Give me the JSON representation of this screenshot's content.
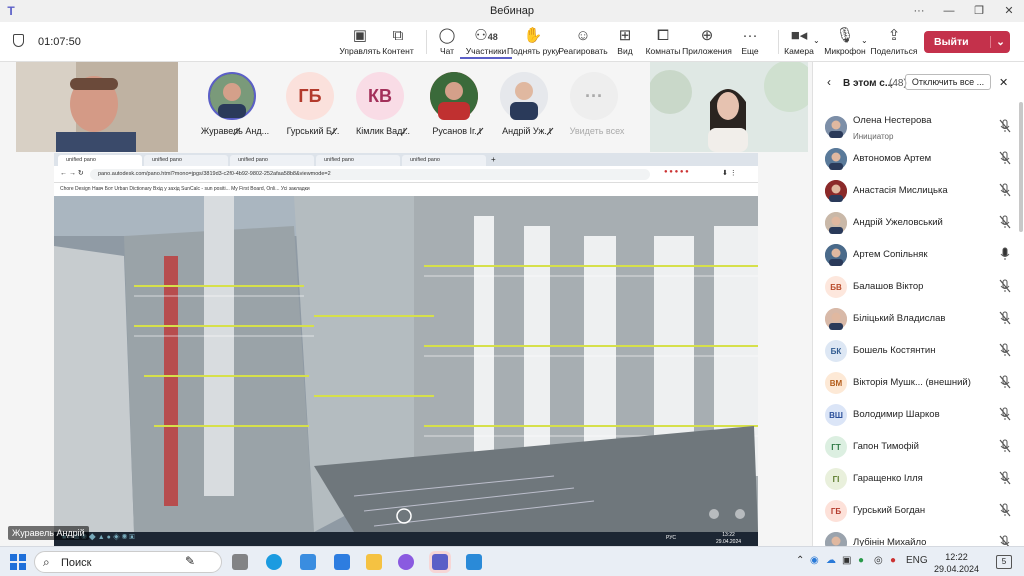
{
  "window": {
    "title": "Вебинар",
    "app_icon": "teams-icon"
  },
  "meeting": {
    "timer": "01:07:50"
  },
  "toolbar": {
    "buttons": [
      {
        "label": "Управлять",
        "icon": "present-icon"
      },
      {
        "label": "Контент",
        "icon": "share-icon"
      },
      {
        "label": "Чат",
        "icon": "chat-icon"
      },
      {
        "label": "Участники",
        "icon": "people-icon",
        "badge": "48"
      },
      {
        "label": "Поднять руку",
        "icon": "hand-icon"
      },
      {
        "label": "Реагировать",
        "icon": "react-icon"
      },
      {
        "label": "Вид",
        "icon": "view-icon"
      },
      {
        "label": "Комнаты",
        "icon": "rooms-icon"
      },
      {
        "label": "Приложения",
        "icon": "apps-icon"
      },
      {
        "label": "Еще",
        "icon": "more-icon"
      },
      {
        "label": "Камера",
        "icon": "camera-icon"
      },
      {
        "label": "Микрофон",
        "icon": "mic-off-icon"
      },
      {
        "label": "Поделиться",
        "icon": "upload-icon"
      }
    ],
    "leave_label": "Выйти"
  },
  "gallery": {
    "participants": [
      {
        "name": "Журавель Анд...",
        "type": "photo"
      },
      {
        "name": "Гурський Б...",
        "initials": "ГБ",
        "color": "#fbe1dc",
        "text_color": "#b33a2c"
      },
      {
        "name": "Кімлик Вад...",
        "initials": "КВ",
        "color": "#f9dce6",
        "text_color": "#a3305a"
      },
      {
        "name": "Русанов Іг...",
        "type": "photo"
      },
      {
        "name": "Андрій Уж...",
        "type": "photo"
      }
    ],
    "see_all": "Увидеть всех"
  },
  "share": {
    "presenter": "Журавель Андрій",
    "tabs": [
      "unified pano",
      "unified pano",
      "unified pano",
      "unified pano",
      "unified pano"
    ],
    "url": "pano.autodesk.com/pano.html?mono=jpgs/3819d3-c2f0-4b92-9802-252afaa58b8&viewmode=2",
    "bookmarks": "Chore  Design  Навч  Бот  Urban Dictionary  Вхід у захід  SunCalc - sun positi...  My First Board, Onli...  Усі закладки",
    "clock": "13:22",
    "date": "29.04.2024",
    "lang": "РУС"
  },
  "panel": {
    "title": "В этом с...",
    "count": "(48)",
    "mute_all": "Отключить все ...",
    "participants": [
      {
        "name": "Олена Нестерова",
        "role": "Инициатор",
        "avatar": "photo",
        "color": "#7d8fa8",
        "mic": "off"
      },
      {
        "name": "Автономов Артем",
        "avatar": "photo",
        "color": "#5a7a9a",
        "mic": "off"
      },
      {
        "name": "Анастасія Мислицька",
        "avatar": "photo",
        "color": "#8b2a2a",
        "mic": "off"
      },
      {
        "name": "Андрій Ужеловський",
        "avatar": "photo",
        "color": "#c9b8a8",
        "mic": "off"
      },
      {
        "name": "Артем Сопільняк",
        "avatar": "photo",
        "color": "#4a6a8a",
        "mic": "on"
      },
      {
        "name": "Балашов Віктор",
        "initials": "БВ",
        "color": "#fde7dd",
        "text_color": "#b84a2a",
        "mic": "off"
      },
      {
        "name": "Біліцький Владислав",
        "avatar": "photo",
        "color": "#d8b9a8",
        "mic": "off"
      },
      {
        "name": "Бошель Костянтин",
        "initials": "БК",
        "color": "#dde7f4",
        "text_color": "#2f5a8f",
        "mic": "off"
      },
      {
        "name": "Вікторія Мушк... (внешний)",
        "initials": "ВМ",
        "color": "#fde9d6",
        "text_color": "#b35c1a",
        "mic": "off"
      },
      {
        "name": "Володимир Шарков",
        "initials": "ВШ",
        "color": "#dbe5f7",
        "text_color": "#2b4f9a",
        "mic": "off"
      },
      {
        "name": "Гапон Тимофій",
        "initials": "ГТ",
        "color": "#dcefe1",
        "text_color": "#2f7a45",
        "mic": "off"
      },
      {
        "name": "Гаращенко Ілля",
        "initials": "ГІ",
        "color": "#e9f0dc",
        "text_color": "#5a7a2a",
        "mic": "off"
      },
      {
        "name": "Гурський Богдан",
        "initials": "ГБ",
        "color": "#fde1d9",
        "text_color": "#b33a2c",
        "mic": "off"
      },
      {
        "name": "Лубінін Михайло",
        "avatar": "photo",
        "color": "#9aa3ad",
        "mic": "off"
      }
    ]
  },
  "taskbar": {
    "search_label": "Поиск",
    "lang": "ENG",
    "time": "12:22",
    "date": "29.04.2024",
    "notifications": "5"
  }
}
